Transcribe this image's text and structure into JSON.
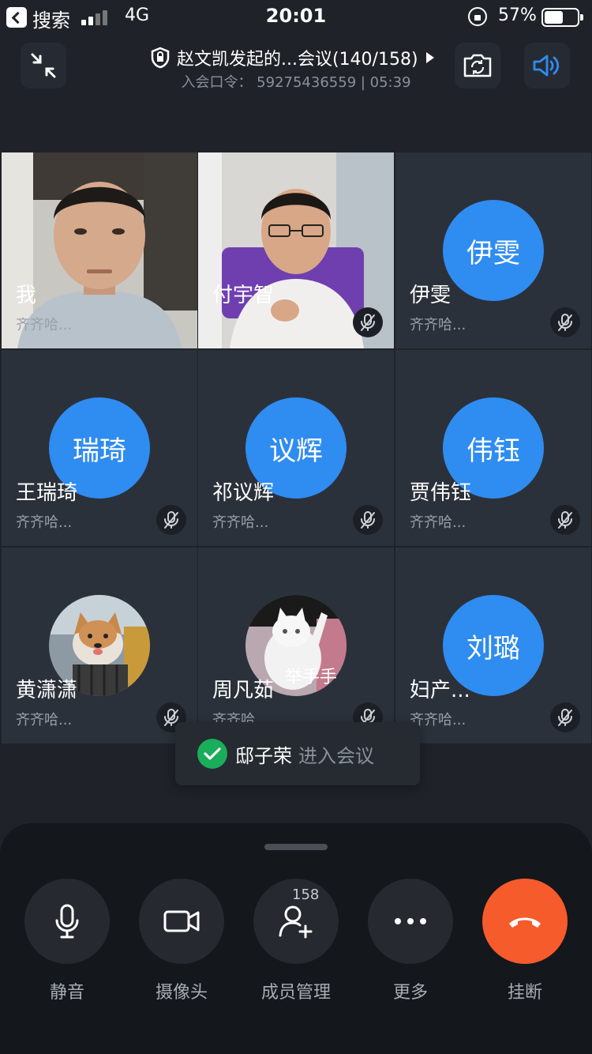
{
  "status_bar": {
    "back_label": "搜索",
    "network": "4G",
    "time": "20:01",
    "battery_text": "57%",
    "battery_level": 0.57
  },
  "header": {
    "title": "赵文凯发起的...会议(140/158)",
    "subtitle": "入会口令： 59275436559 | 05:39"
  },
  "participants": [
    {
      "name": "我",
      "org": "齐齐哈...",
      "type": "video"
    },
    {
      "name": "付宇智",
      "org": "",
      "type": "video"
    },
    {
      "name": "伊雯",
      "org": "齐齐哈...",
      "type": "avatar",
      "avatar_text": "伊雯"
    },
    {
      "name": "王瑞琦",
      "org": "齐齐哈...",
      "type": "avatar",
      "avatar_text": "瑞琦"
    },
    {
      "name": "祁议辉",
      "org": "齐齐哈...",
      "type": "avatar",
      "avatar_text": "议辉"
    },
    {
      "name": "贾伟钰",
      "org": "齐齐哈...",
      "type": "avatar",
      "avatar_text": "伟钰"
    },
    {
      "name": "黄潇潇",
      "org": "齐齐哈...",
      "type": "photo"
    },
    {
      "name": "周凡茹",
      "org": "齐齐哈",
      "type": "photo",
      "photo_caption": "举手手"
    },
    {
      "name": "妇产...",
      "org": "齐齐哈...",
      "type": "avatar",
      "avatar_text": "刘璐"
    }
  ],
  "toast": {
    "name": "邸子荣",
    "action": "进入会议"
  },
  "controls": {
    "mute_label": "静音",
    "camera_label": "摄像头",
    "members_label": "成员管理",
    "members_count": "158",
    "more_label": "更多",
    "hangup_label": "挂断"
  },
  "colors": {
    "background": "#1f2329",
    "avatar_blue": "#2f8cf0",
    "hangup_orange": "#f65b2c",
    "speaker_blue": "#2f8cf0",
    "toast_green": "#1aad5a"
  }
}
